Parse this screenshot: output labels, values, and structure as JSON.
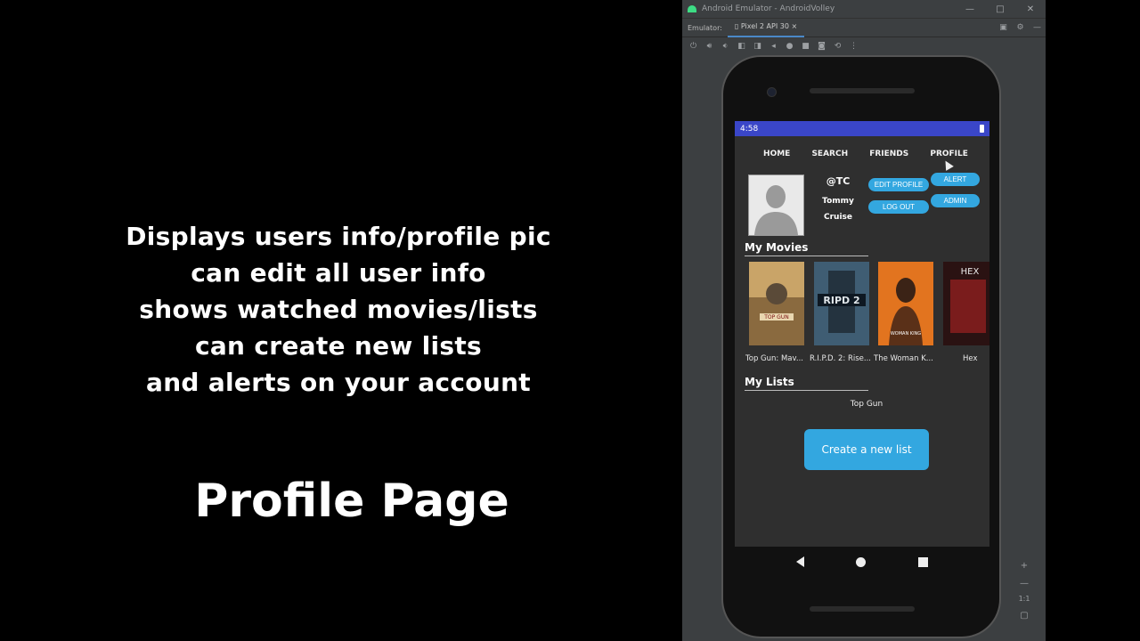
{
  "caption": {
    "lines": [
      "Displays users info/profile pic",
      "can edit all user info",
      "shows watched movies/lists",
      "can create new lists",
      "and alerts on your account"
    ],
    "title": "Profile Page"
  },
  "emulator": {
    "window_title": "Android Emulator - AndroidVolley",
    "tab_label": "Emulator:",
    "device_tab": "Pixel 2 API 30",
    "window_controls": [
      "—",
      "□",
      "✕"
    ],
    "zoom_ratio": "1:1"
  },
  "phone": {
    "status_time": "4:58",
    "nav": [
      "HOME",
      "SEARCH",
      "FRIENDS",
      "PROFILE"
    ],
    "user": {
      "handle": "@TC",
      "first_name": "Tommy",
      "last_name": "Cruise"
    },
    "buttons": {
      "edit_profile": "EDIT PROFILE",
      "alert": "ALERT",
      "log_out": "LOG OUT",
      "admin": "ADMIN"
    },
    "my_movies_heading": "My Movies",
    "movies": [
      {
        "caption": "Top Gun: Mav...",
        "poster_text": "TOP GUN",
        "color": "#d6a35a"
      },
      {
        "caption": "R.I.P.D. 2: Rise...",
        "poster_text": "RIPD 2",
        "color": "#4c6e86"
      },
      {
        "caption": "The Woman K...",
        "poster_text": "WOMAN KING",
        "color": "#e0711f"
      },
      {
        "caption": "Hex",
        "poster_text": "HEX",
        "color": "#7a1c1c"
      }
    ],
    "my_lists_heading": "My Lists",
    "lists": [
      "Top Gun"
    ],
    "create_button": "Create a new list"
  },
  "colors": {
    "accent": "#33a7e0",
    "status_bar": "#3a46c8",
    "screen_bg": "#2f2f2f"
  }
}
